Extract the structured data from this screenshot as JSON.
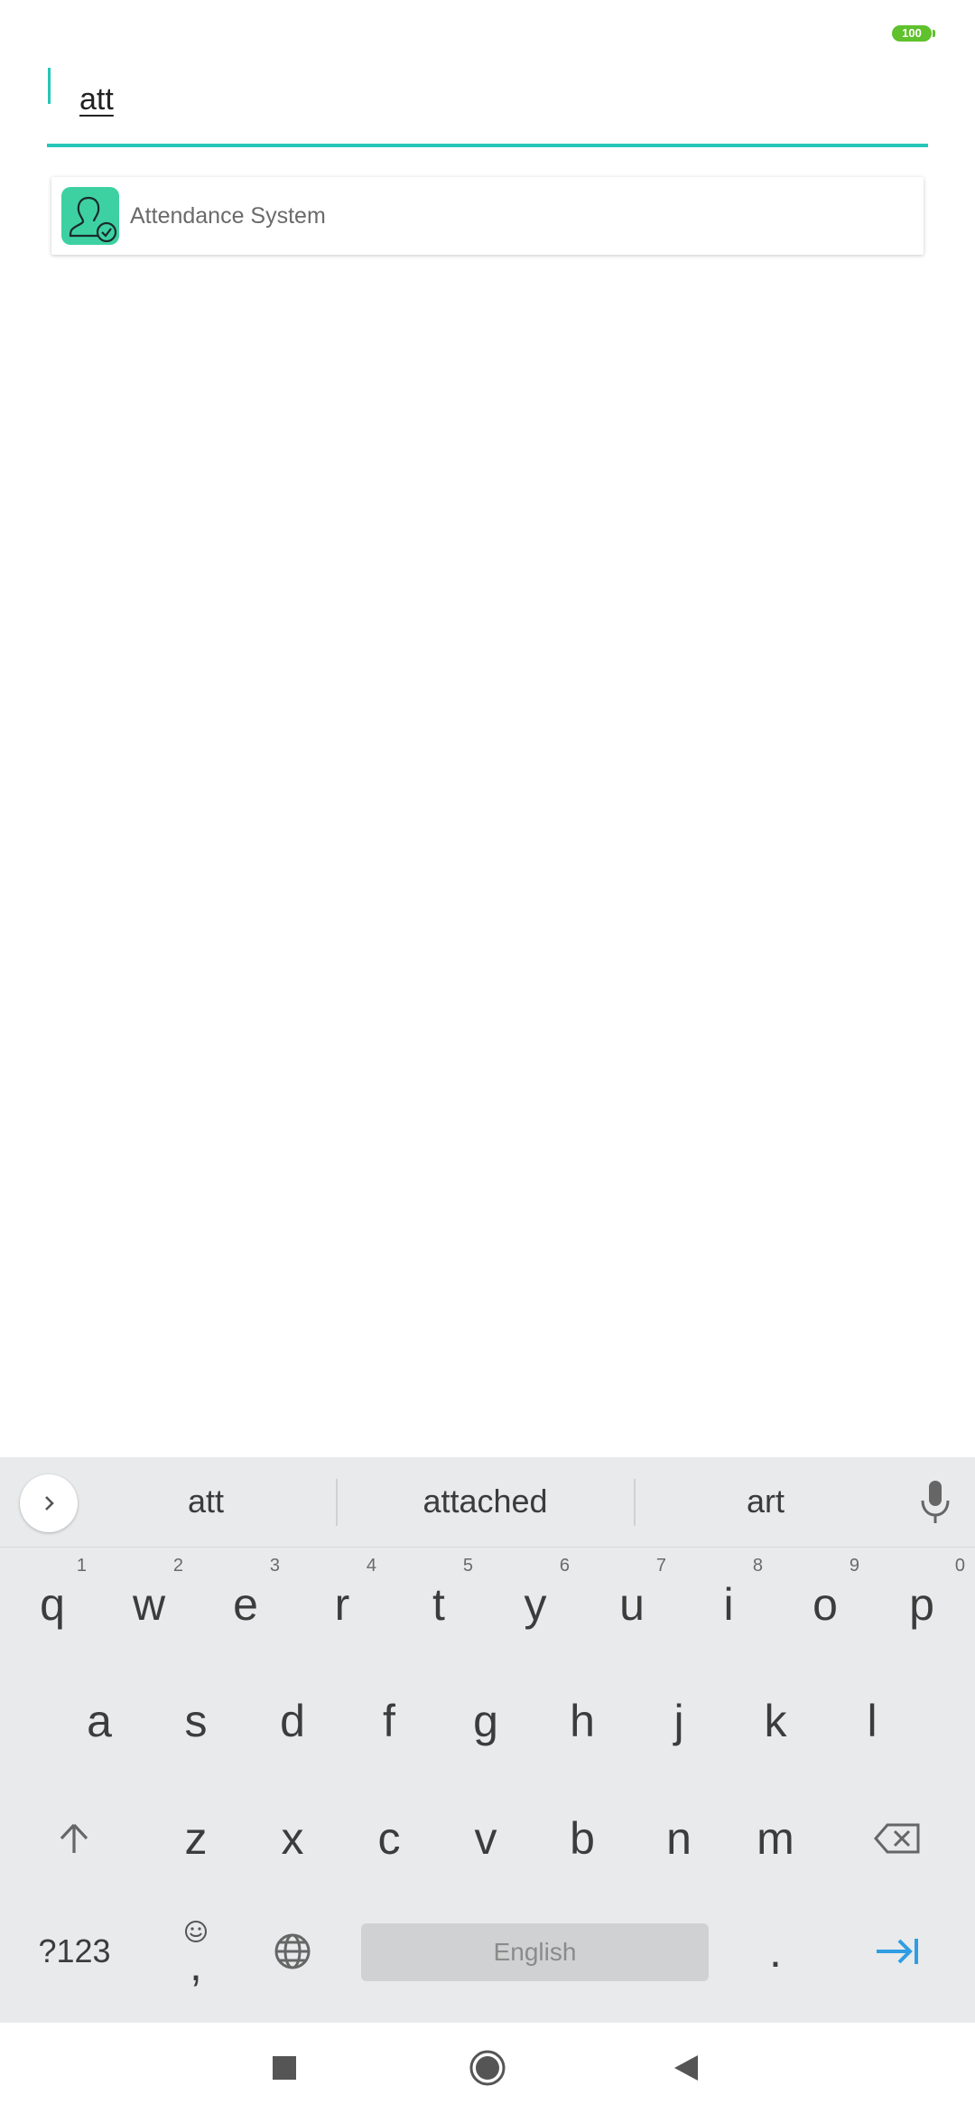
{
  "status_bar": {
    "battery": "100"
  },
  "search": {
    "query": "att"
  },
  "results": [
    {
      "label": "Attendance System"
    }
  ],
  "keyboard": {
    "suggestions": [
      "att",
      "attached",
      "art"
    ],
    "row1": [
      {
        "key": "q",
        "hint": "1"
      },
      {
        "key": "w",
        "hint": "2"
      },
      {
        "key": "e",
        "hint": "3"
      },
      {
        "key": "r",
        "hint": "4"
      },
      {
        "key": "t",
        "hint": "5"
      },
      {
        "key": "y",
        "hint": "6"
      },
      {
        "key": "u",
        "hint": "7"
      },
      {
        "key": "i",
        "hint": "8"
      },
      {
        "key": "o",
        "hint": "9"
      },
      {
        "key": "p",
        "hint": "0"
      }
    ],
    "row2": [
      "a",
      "s",
      "d",
      "f",
      "g",
      "h",
      "j",
      "k",
      "l"
    ],
    "row3": [
      "z",
      "x",
      "c",
      "v",
      "b",
      "n",
      "m"
    ],
    "symbols_label": "?123",
    "comma": ",",
    "space_label": "English",
    "period": "."
  },
  "colors": {
    "accent": "#26c6b9",
    "battery": "#5fc12c",
    "app_icon": "#3dd1a1",
    "enter": "#2f9de3"
  }
}
